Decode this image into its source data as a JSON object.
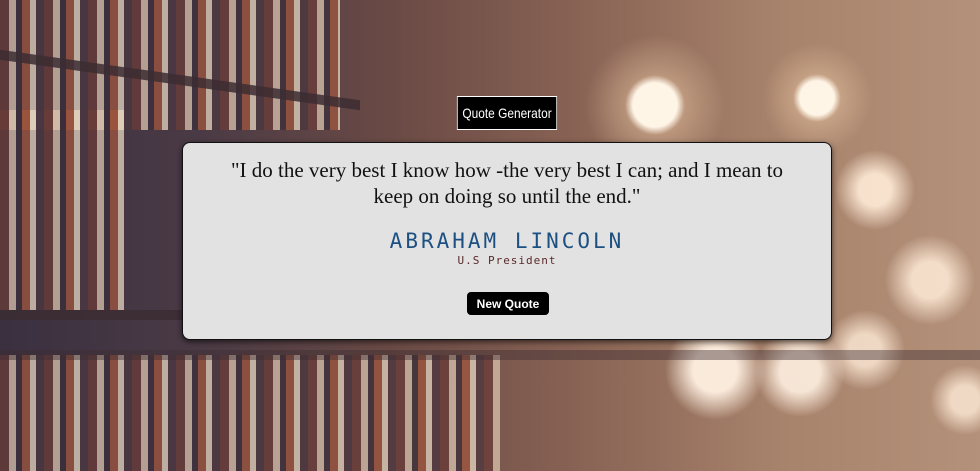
{
  "header": {
    "title": "Quote Generator"
  },
  "quote": {
    "text": "\"I do the very best I know how -the very best I can; and I mean to keep on doing so until the end.\"",
    "author": "ABRAHAM LINCOLN",
    "role": "U.S President"
  },
  "actions": {
    "new_quote_label": "New Quote"
  },
  "colors": {
    "card": "#e2e2e2",
    "author": "#1d5082",
    "button": "#000000"
  }
}
